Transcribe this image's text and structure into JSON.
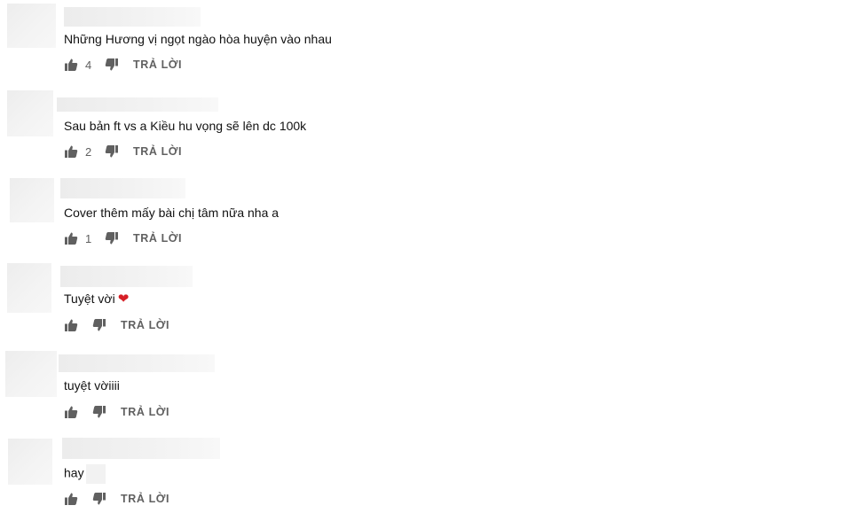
{
  "comments": [
    {
      "text": "Những Hương vị ngọt ngào hòa huyện vào nhau",
      "likes": "4",
      "reply_label": "TRẢ LỜI"
    },
    {
      "text": "Sau bản ft vs a Kiều hu vọng sẽ lên dc 100k",
      "likes": "2",
      "reply_label": "TRẢ LỜI"
    },
    {
      "text": "Cover thêm mấy bài chị tâm nữa nha a",
      "likes": "1",
      "reply_label": "TRẢ LỜI"
    },
    {
      "text": "Tuyệt vời",
      "emoji": "❤",
      "likes": "",
      "reply_label": "TRẢ LỜI"
    },
    {
      "text": "tuyệt vờiiii",
      "likes": "",
      "reply_label": "TRẢ LỜI"
    },
    {
      "text": "hay",
      "likes": "",
      "reply_label": "TRẢ LỜI"
    }
  ],
  "icons": {
    "like": "thumb-up-icon",
    "dislike": "thumb-down-icon"
  },
  "colors": {
    "text": "#111111",
    "secondary": "#606060",
    "heart": "#d61f26"
  }
}
